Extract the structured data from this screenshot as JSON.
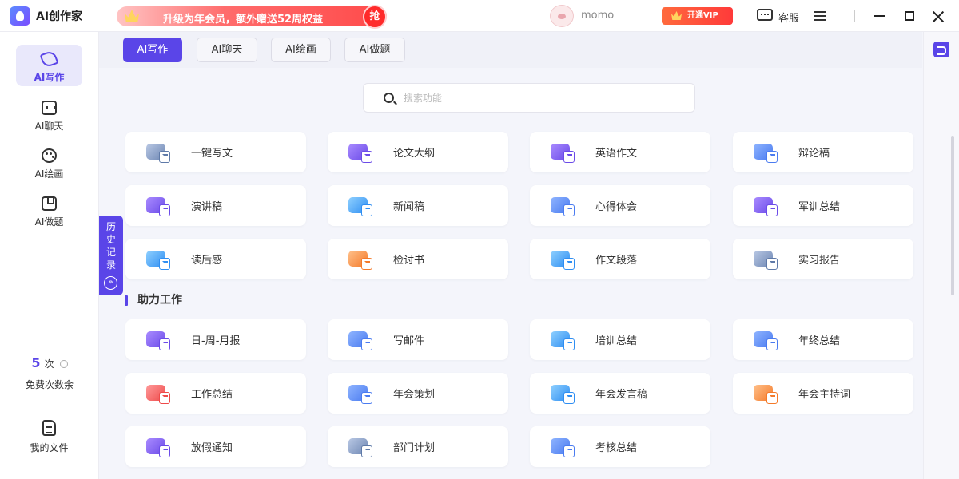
{
  "app": {
    "title": "AI创作家"
  },
  "promo": {
    "text": "升级为年会员，额外赠送52周权益",
    "badge": "抢"
  },
  "user": {
    "name": "momo"
  },
  "vip": {
    "label": "开通VIP"
  },
  "service": {
    "label": "客服"
  },
  "sidebar": {
    "items": [
      {
        "label": "AI写作",
        "icon": "pen-icon",
        "active": true
      },
      {
        "label": "AI聊天",
        "icon": "chat-bot-icon",
        "active": false
      },
      {
        "label": "AI绘画",
        "icon": "palette-icon",
        "active": false
      },
      {
        "label": "AI做题",
        "icon": "bookmark-icon",
        "active": false
      }
    ],
    "credits": {
      "count": "5",
      "unit": "次",
      "label": "免费次数余"
    },
    "files": {
      "label": "我的文件"
    }
  },
  "history": {
    "label": "历史记录",
    "arrow": "»"
  },
  "tabs": [
    {
      "label": "AI写作",
      "active": true
    },
    {
      "label": "AI聊天",
      "active": false
    },
    {
      "label": "AI绘画",
      "active": false
    },
    {
      "label": "AI做题",
      "active": false
    }
  ],
  "search": {
    "placeholder": "搜索功能",
    "value": ""
  },
  "writing_tools": [
    {
      "label": "一键写文",
      "color": "gray"
    },
    {
      "label": "论文大纲",
      "color": "purple"
    },
    {
      "label": "英语作文",
      "color": "purple"
    },
    {
      "label": "辩论稿",
      "color": "blue"
    },
    {
      "label": "演讲稿",
      "color": "purple"
    },
    {
      "label": "新闻稿",
      "color": "sky"
    },
    {
      "label": "心得体会",
      "color": "blue"
    },
    {
      "label": "军训总结",
      "color": "purple"
    },
    {
      "label": "读后感",
      "color": "sky"
    },
    {
      "label": "检讨书",
      "color": "orange"
    },
    {
      "label": "作文段落",
      "color": "sky"
    },
    {
      "label": "实习报告",
      "color": "gray"
    }
  ],
  "work_section": {
    "title": "助力工作"
  },
  "work_tools": [
    {
      "label": "日-周-月报",
      "color": "purple"
    },
    {
      "label": "写邮件",
      "color": "blue"
    },
    {
      "label": "培训总结",
      "color": "sky"
    },
    {
      "label": "年终总结",
      "color": "blue"
    },
    {
      "label": "工作总结",
      "color": "red"
    },
    {
      "label": "年会策划",
      "color": "blue"
    },
    {
      "label": "年会发言稿",
      "color": "sky"
    },
    {
      "label": "年会主持词",
      "color": "orange"
    },
    {
      "label": "放假通知",
      "color": "purple"
    },
    {
      "label": "部门计划",
      "color": "gray"
    },
    {
      "label": "考核总结",
      "color": "blue"
    }
  ],
  "colors": {
    "accent": "#5a45e8",
    "promo_red": "#ff4a4a",
    "vip_orange": "#ff6a3d"
  }
}
